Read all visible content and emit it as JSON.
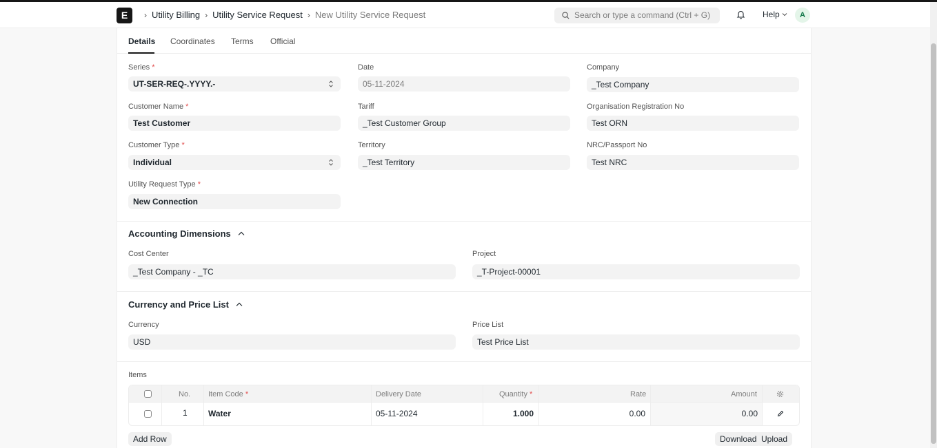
{
  "navbar": {
    "logo": "E",
    "breadcrumbs": [
      "Utility Billing",
      "Utility Service Request",
      "New Utility Service Request"
    ],
    "search_placeholder": "Search or type a command (Ctrl + G)",
    "help_label": "Help",
    "avatar_initial": "A"
  },
  "tabs": [
    "Details",
    "Coordinates",
    "Terms",
    "Official"
  ],
  "details": {
    "series": {
      "label": "Series",
      "value": "UT-SER-REQ-.YYYY.-"
    },
    "date": {
      "label": "Date",
      "value": "05-11-2024"
    },
    "company": {
      "label": "Company",
      "value": "_Test Company"
    },
    "customer_name": {
      "label": "Customer Name",
      "value": "Test Customer"
    },
    "tariff": {
      "label": "Tariff",
      "value": "_Test Customer Group"
    },
    "org_reg_no": {
      "label": "Organisation Registration No",
      "value": "Test ORN"
    },
    "customer_type": {
      "label": "Customer Type",
      "value": "Individual"
    },
    "territory": {
      "label": "Territory",
      "value": "_Test Territory"
    },
    "nrc_passport": {
      "label": "NRC/Passport No",
      "value": "Test NRC"
    },
    "request_type": {
      "label": "Utility Request Type",
      "value": "New Connection"
    }
  },
  "accounting": {
    "title": "Accounting Dimensions",
    "cost_center": {
      "label": "Cost Center",
      "value": "_Test Company - _TC"
    },
    "project": {
      "label": "Project",
      "value": "_T-Project-00001"
    }
  },
  "currency_section": {
    "title": "Currency and Price List",
    "currency": {
      "label": "Currency",
      "value": "USD"
    },
    "price_list": {
      "label": "Price List",
      "value": "Test Price List"
    }
  },
  "items": {
    "label": "Items",
    "columns": {
      "no": "No.",
      "item_code": "Item Code",
      "delivery_date": "Delivery Date",
      "quantity": "Quantity",
      "rate": "Rate",
      "amount": "Amount"
    },
    "rows": [
      {
        "no": "1",
        "item_code": "Water",
        "delivery_date": "05-11-2024",
        "quantity": "1.000",
        "rate": "0.00",
        "amount": "0.00"
      }
    ],
    "add_row": "Add Row",
    "download": "Download",
    "upload": "Upload"
  }
}
